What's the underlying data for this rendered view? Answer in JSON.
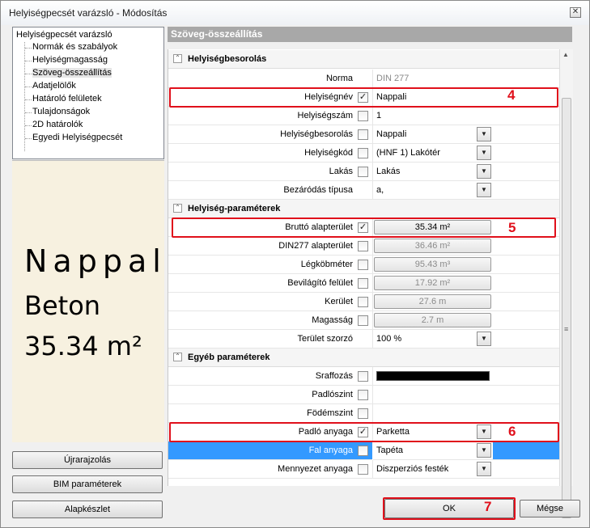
{
  "window": {
    "title": "Helyiségpecsét varázsló - Módosítás"
  },
  "tree": {
    "root": "Helyiségpecsét varázsló",
    "items": [
      "Normák és szabályok",
      "Helyiségmagasság",
      "Szöveg-összeállítás",
      "Adatjelölők",
      "Határoló felületek",
      "Tulajdonságok",
      "2D határolók",
      "Egyedi Helyiségpecsét"
    ]
  },
  "preview": {
    "line1": "Nappali",
    "line2": "Beton",
    "line3": "35.34 m²"
  },
  "left_buttons": {
    "redraw": "Újrarajzolás",
    "bim": "BIM paraméterek",
    "defaults": "Alapkészlet"
  },
  "panel": {
    "title": "Szöveg-összeállítás"
  },
  "sections": {
    "s1": "Helyiségbesorolás",
    "s2": "Helyiség-paraméterek",
    "s3": "Egyéb paraméterek"
  },
  "rows": {
    "norma": {
      "label": "Norma",
      "value": "DIN 277"
    },
    "nev": {
      "label": "Helyiségnév",
      "value": "Nappali"
    },
    "szam": {
      "label": "Helyiségszám",
      "value": "1"
    },
    "besorolas": {
      "label": "Helyiségbesorolás",
      "value": "Nappali"
    },
    "kod": {
      "label": "Helyiségkód",
      "value": "(HNF 1) Lakótér"
    },
    "lakas": {
      "label": "Lakás",
      "value": "Lakás"
    },
    "bezarodas": {
      "label": "Bezáródás típusa",
      "value": "a,"
    },
    "brutto": {
      "label": "Bruttó alapterület",
      "value": "35.34 m²"
    },
    "din277": {
      "label": "DIN277 alapterület",
      "value": "36.46 m²"
    },
    "legkob": {
      "label": "Légköbméter",
      "value": "95.43 m³"
    },
    "bevilagito": {
      "label": "Bevilágító felület",
      "value": "17.92 m²"
    },
    "kerulet": {
      "label": "Kerület",
      "value": "27.6 m"
    },
    "magassag": {
      "label": "Magasság",
      "value": "2.7 m"
    },
    "szorzo": {
      "label": "Terület szorzó",
      "value": "100 %"
    },
    "sraffozas": {
      "label": "Sraffozás",
      "value": ""
    },
    "padloszint": {
      "label": "Padlószint",
      "value": ""
    },
    "fodemszint": {
      "label": "Födémszint",
      "value": ""
    },
    "padlo": {
      "label": "Padló anyaga",
      "value": "Parketta"
    },
    "fal": {
      "label": "Fal anyaga",
      "value": "Tapéta"
    },
    "mennyezet": {
      "label": "Mennyezet anyaga",
      "value": "Diszperziós festék"
    }
  },
  "callouts": {
    "n4": "4",
    "n5": "5",
    "n6": "6",
    "n7": "7"
  },
  "footer": {
    "ok": "OK",
    "cancel": "Mégse"
  },
  "colors": {
    "highlight": "#e0101b",
    "selection": "#3399ff",
    "preview_bg": "#f7f1e0"
  }
}
